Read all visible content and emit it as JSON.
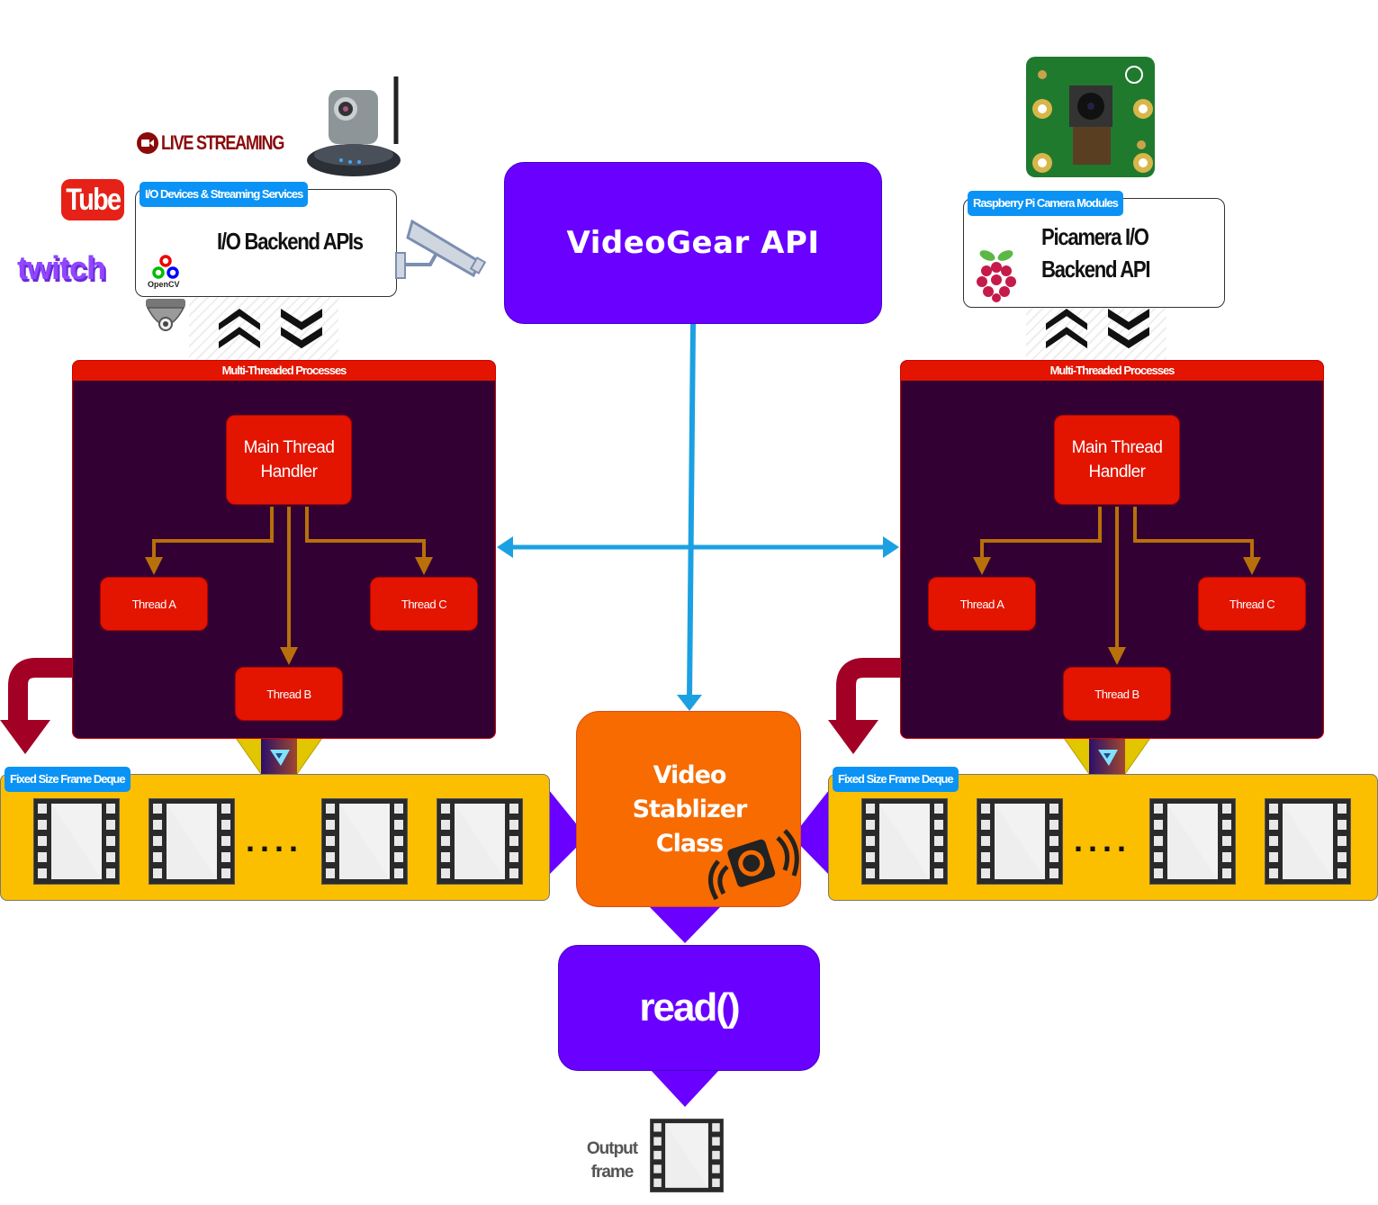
{
  "title": "VideoGear API",
  "left_source": {
    "tag": "I/O Devices & Streaming Services",
    "title": "I/O Backend APIs",
    "opencv_label": "OpenCV",
    "live_streaming": "LIVE STREAMING",
    "youtube_label": "Tube",
    "twitch_label": "twitch"
  },
  "right_source": {
    "tag": "Raspberry Pi Camera Modules",
    "title_line1": "Picamera I/O",
    "title_line2": "Backend API"
  },
  "processes": {
    "header": "Multi-Threaded Processes",
    "main_line1": "Main Thread",
    "main_line2": "Handler",
    "thread_a": "Thread A",
    "thread_b": "Thread B",
    "thread_c": "Thread C"
  },
  "deque": {
    "tag": "Fixed Size Frame Deque",
    "ellipsis": "...."
  },
  "stabilizer": {
    "line1": "Video",
    "line2": "Stablizer",
    "line3": "Class"
  },
  "read": {
    "label": "read()"
  },
  "output": {
    "line1": "Output",
    "line2": "frame"
  },
  "colors": {
    "api_purple": "#6a00ff",
    "process_bg": "#330033",
    "thread_red": "#e31500",
    "deque_yellow": "#fbbf00",
    "tag_blue": "#0a93f5",
    "stabilizer_orange": "#f76b00",
    "connector_blue": "#1ba1e2",
    "thread_arrow": "#b8700a",
    "return_arrow": "#a20025"
  }
}
